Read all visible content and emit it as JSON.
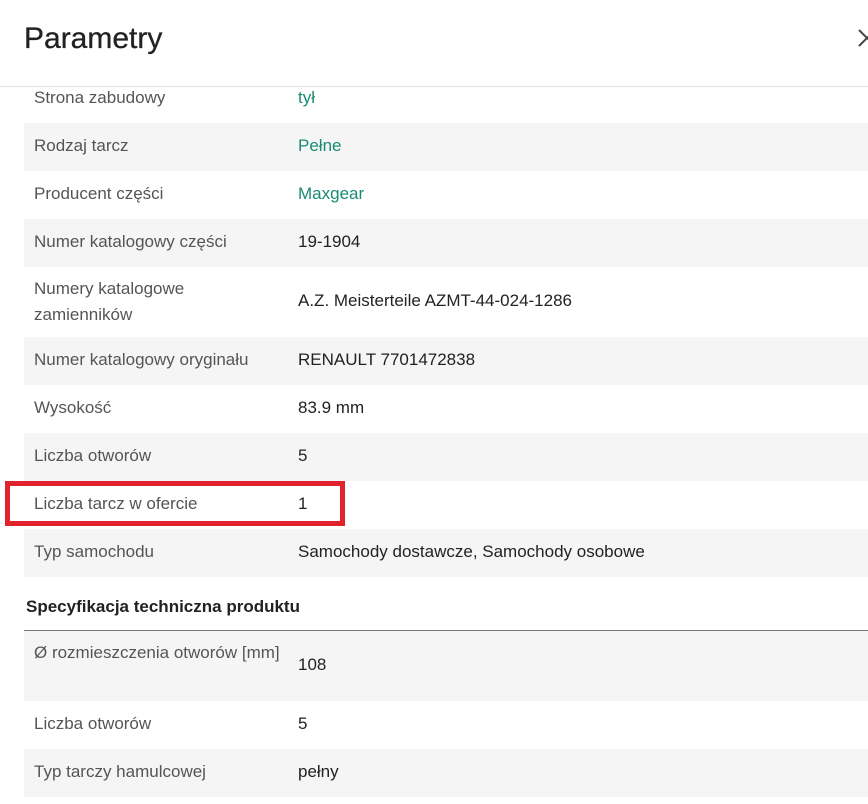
{
  "header": {
    "title": "Parametry"
  },
  "params": [
    {
      "label": "Strona zabudowy",
      "value": "tył"
    },
    {
      "label": "Rodzaj tarcz",
      "value": "Pełne"
    },
    {
      "label": "Producent części",
      "value": "Maxgear"
    },
    {
      "label": "Numer katalogowy części",
      "value": "19-1904"
    },
    {
      "label": "Numery katalogowe zamienników",
      "value": "A.Z. Meisterteile AZMT-44-024-1286"
    },
    {
      "label": "Numer katalogowy oryginału",
      "value": "RENAULT 7701472838"
    },
    {
      "label": "Wysokość",
      "value": "83.9 mm"
    },
    {
      "label": "Liczba otworów",
      "value": "5"
    },
    {
      "label": "Liczba tarcz w ofercie",
      "value": "1"
    },
    {
      "label": "Typ samochodu",
      "value": "Samochody dostawcze, Samochody osobowe"
    }
  ],
  "spec": {
    "heading": "Specyfikacja techniczna produktu",
    "rows": [
      {
        "label": "Ø rozmieszczenia otworów [mm]",
        "value": "108"
      },
      {
        "label": "Liczba otworów",
        "value": "5"
      },
      {
        "label": "Typ tarczy hamulcowej",
        "value": "pełny"
      }
    ]
  },
  "colors": {
    "link": "#1a8a74",
    "highlight": "#e1232d",
    "stripe": "#f5f5f5"
  },
  "icons": {
    "close": "close-icon"
  }
}
